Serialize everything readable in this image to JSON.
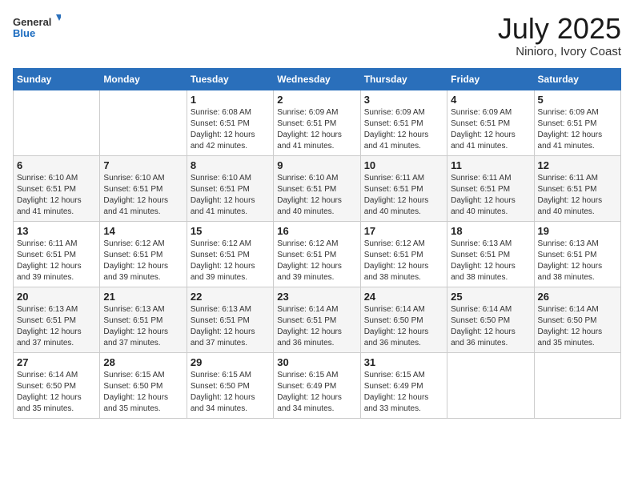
{
  "header": {
    "logo_general": "General",
    "logo_blue": "Blue",
    "month_year": "July 2025",
    "location": "Ninioro, Ivory Coast"
  },
  "days_of_week": [
    "Sunday",
    "Monday",
    "Tuesday",
    "Wednesday",
    "Thursday",
    "Friday",
    "Saturday"
  ],
  "weeks": [
    [
      {
        "day": "",
        "sunrise": "",
        "sunset": "",
        "daylight": ""
      },
      {
        "day": "",
        "sunrise": "",
        "sunset": "",
        "daylight": ""
      },
      {
        "day": "1",
        "sunrise": "Sunrise: 6:08 AM",
        "sunset": "Sunset: 6:51 PM",
        "daylight": "Daylight: 12 hours and 42 minutes."
      },
      {
        "day": "2",
        "sunrise": "Sunrise: 6:09 AM",
        "sunset": "Sunset: 6:51 PM",
        "daylight": "Daylight: 12 hours and 41 minutes."
      },
      {
        "day": "3",
        "sunrise": "Sunrise: 6:09 AM",
        "sunset": "Sunset: 6:51 PM",
        "daylight": "Daylight: 12 hours and 41 minutes."
      },
      {
        "day": "4",
        "sunrise": "Sunrise: 6:09 AM",
        "sunset": "Sunset: 6:51 PM",
        "daylight": "Daylight: 12 hours and 41 minutes."
      },
      {
        "day": "5",
        "sunrise": "Sunrise: 6:09 AM",
        "sunset": "Sunset: 6:51 PM",
        "daylight": "Daylight: 12 hours and 41 minutes."
      }
    ],
    [
      {
        "day": "6",
        "sunrise": "Sunrise: 6:10 AM",
        "sunset": "Sunset: 6:51 PM",
        "daylight": "Daylight: 12 hours and 41 minutes."
      },
      {
        "day": "7",
        "sunrise": "Sunrise: 6:10 AM",
        "sunset": "Sunset: 6:51 PM",
        "daylight": "Daylight: 12 hours and 41 minutes."
      },
      {
        "day": "8",
        "sunrise": "Sunrise: 6:10 AM",
        "sunset": "Sunset: 6:51 PM",
        "daylight": "Daylight: 12 hours and 41 minutes."
      },
      {
        "day": "9",
        "sunrise": "Sunrise: 6:10 AM",
        "sunset": "Sunset: 6:51 PM",
        "daylight": "Daylight: 12 hours and 40 minutes."
      },
      {
        "day": "10",
        "sunrise": "Sunrise: 6:11 AM",
        "sunset": "Sunset: 6:51 PM",
        "daylight": "Daylight: 12 hours and 40 minutes."
      },
      {
        "day": "11",
        "sunrise": "Sunrise: 6:11 AM",
        "sunset": "Sunset: 6:51 PM",
        "daylight": "Daylight: 12 hours and 40 minutes."
      },
      {
        "day": "12",
        "sunrise": "Sunrise: 6:11 AM",
        "sunset": "Sunset: 6:51 PM",
        "daylight": "Daylight: 12 hours and 40 minutes."
      }
    ],
    [
      {
        "day": "13",
        "sunrise": "Sunrise: 6:11 AM",
        "sunset": "Sunset: 6:51 PM",
        "daylight": "Daylight: 12 hours and 39 minutes."
      },
      {
        "day": "14",
        "sunrise": "Sunrise: 6:12 AM",
        "sunset": "Sunset: 6:51 PM",
        "daylight": "Daylight: 12 hours and 39 minutes."
      },
      {
        "day": "15",
        "sunrise": "Sunrise: 6:12 AM",
        "sunset": "Sunset: 6:51 PM",
        "daylight": "Daylight: 12 hours and 39 minutes."
      },
      {
        "day": "16",
        "sunrise": "Sunrise: 6:12 AM",
        "sunset": "Sunset: 6:51 PM",
        "daylight": "Daylight: 12 hours and 39 minutes."
      },
      {
        "day": "17",
        "sunrise": "Sunrise: 6:12 AM",
        "sunset": "Sunset: 6:51 PM",
        "daylight": "Daylight: 12 hours and 38 minutes."
      },
      {
        "day": "18",
        "sunrise": "Sunrise: 6:13 AM",
        "sunset": "Sunset: 6:51 PM",
        "daylight": "Daylight: 12 hours and 38 minutes."
      },
      {
        "day": "19",
        "sunrise": "Sunrise: 6:13 AM",
        "sunset": "Sunset: 6:51 PM",
        "daylight": "Daylight: 12 hours and 38 minutes."
      }
    ],
    [
      {
        "day": "20",
        "sunrise": "Sunrise: 6:13 AM",
        "sunset": "Sunset: 6:51 PM",
        "daylight": "Daylight: 12 hours and 37 minutes."
      },
      {
        "day": "21",
        "sunrise": "Sunrise: 6:13 AM",
        "sunset": "Sunset: 6:51 PM",
        "daylight": "Daylight: 12 hours and 37 minutes."
      },
      {
        "day": "22",
        "sunrise": "Sunrise: 6:13 AM",
        "sunset": "Sunset: 6:51 PM",
        "daylight": "Daylight: 12 hours and 37 minutes."
      },
      {
        "day": "23",
        "sunrise": "Sunrise: 6:14 AM",
        "sunset": "Sunset: 6:51 PM",
        "daylight": "Daylight: 12 hours and 36 minutes."
      },
      {
        "day": "24",
        "sunrise": "Sunrise: 6:14 AM",
        "sunset": "Sunset: 6:50 PM",
        "daylight": "Daylight: 12 hours and 36 minutes."
      },
      {
        "day": "25",
        "sunrise": "Sunrise: 6:14 AM",
        "sunset": "Sunset: 6:50 PM",
        "daylight": "Daylight: 12 hours and 36 minutes."
      },
      {
        "day": "26",
        "sunrise": "Sunrise: 6:14 AM",
        "sunset": "Sunset: 6:50 PM",
        "daylight": "Daylight: 12 hours and 35 minutes."
      }
    ],
    [
      {
        "day": "27",
        "sunrise": "Sunrise: 6:14 AM",
        "sunset": "Sunset: 6:50 PM",
        "daylight": "Daylight: 12 hours and 35 minutes."
      },
      {
        "day": "28",
        "sunrise": "Sunrise: 6:15 AM",
        "sunset": "Sunset: 6:50 PM",
        "daylight": "Daylight: 12 hours and 35 minutes."
      },
      {
        "day": "29",
        "sunrise": "Sunrise: 6:15 AM",
        "sunset": "Sunset: 6:50 PM",
        "daylight": "Daylight: 12 hours and 34 minutes."
      },
      {
        "day": "30",
        "sunrise": "Sunrise: 6:15 AM",
        "sunset": "Sunset: 6:49 PM",
        "daylight": "Daylight: 12 hours and 34 minutes."
      },
      {
        "day": "31",
        "sunrise": "Sunrise: 6:15 AM",
        "sunset": "Sunset: 6:49 PM",
        "daylight": "Daylight: 12 hours and 33 minutes."
      },
      {
        "day": "",
        "sunrise": "",
        "sunset": "",
        "daylight": ""
      },
      {
        "day": "",
        "sunrise": "",
        "sunset": "",
        "daylight": ""
      }
    ]
  ]
}
